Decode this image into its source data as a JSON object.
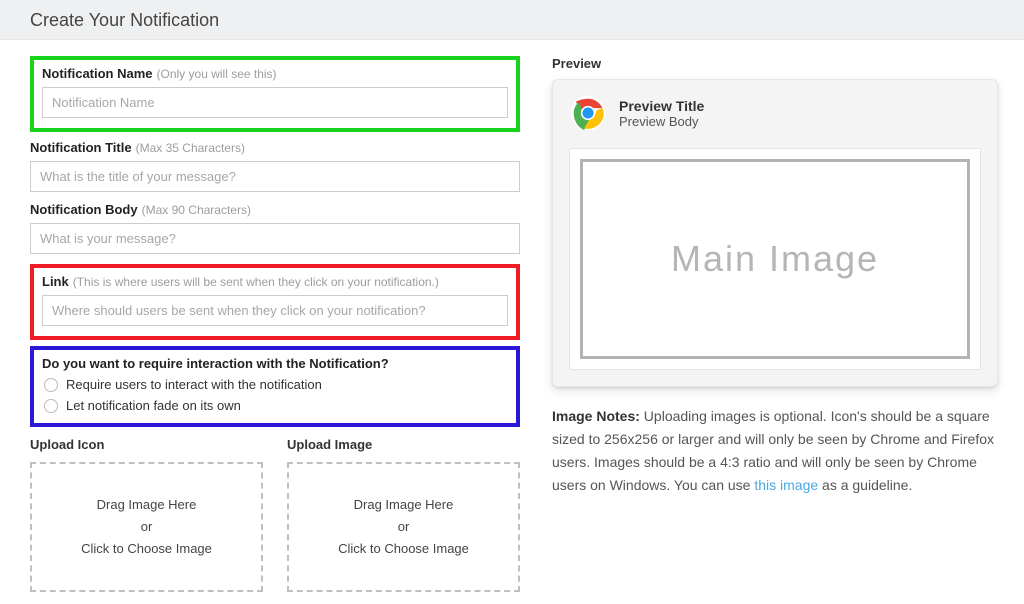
{
  "header": {
    "title": "Create Your Notification"
  },
  "fields": {
    "name": {
      "label": "Notification Name",
      "hint": "(Only you will see this)",
      "placeholder": "Notification Name"
    },
    "title": {
      "label": "Notification Title",
      "hint": "(Max 35 Characters)",
      "placeholder": "What is the title of your message?"
    },
    "body": {
      "label": "Notification Body",
      "hint": "(Max 90 Characters)",
      "placeholder": "What is your message?"
    },
    "link": {
      "label": "Link",
      "hint": "(This is where users will be sent when they click on your notification.)",
      "placeholder": "Where should users be sent when they click on your notification?"
    }
  },
  "interaction": {
    "question": "Do you want to require interaction with the Notification?",
    "option1": "Require users to interact with the notification",
    "option2": "Let notification fade on its own"
  },
  "upload": {
    "icon_label": "Upload Icon",
    "image_label": "Upload Image",
    "drag_text": "Drag Image Here",
    "or_text": "or",
    "click_text": "Click to Choose Image"
  },
  "preview": {
    "label": "Preview",
    "title": "Preview Title",
    "body": "Preview Body",
    "main_image_text": "Main Image"
  },
  "notes": {
    "lead": "Image Notes:",
    "body_before_link": " Uploading images is optional. Icon's should be a square sized to 256x256 or larger and will only be seen by Chrome and Firefox users. Images should be a 4:3 ratio and will only be seen by Chrome users on Windows. You can use ",
    "link_text": "this image",
    "body_after_link": " as a guideline."
  }
}
